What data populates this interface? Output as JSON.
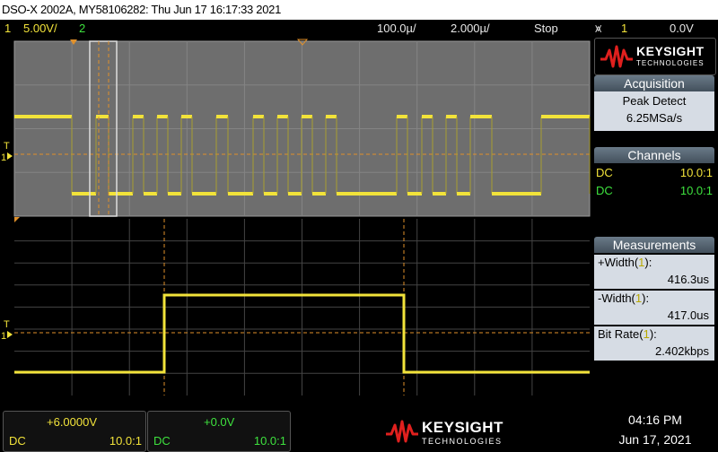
{
  "title": "DSO-X 2002A, MY58106282: Thu Jun 17 16:17:33 2021",
  "status": {
    "ch1_num": "1",
    "ch1_scale": "5.00V/",
    "ch2_num": "2",
    "time_ref": "100.0µ/",
    "time_scale": "2.000µ/",
    "run_state": "Stop",
    "trigger_icon": "⩙",
    "trigger_src": "1",
    "trigger_level": "0.0V"
  },
  "colors": {
    "ch1": "#f2e33a",
    "ch2": "#3ee23e",
    "grid": "#7a7a7a"
  },
  "brand": {
    "name": "KEYSIGHT",
    "sub": "TECHNOLOGIES"
  },
  "acquisition": {
    "header": "Acquisition",
    "mode": "Peak Detect",
    "rate": "6.25MSa/s"
  },
  "channels": {
    "header": "Channels",
    "rows": [
      {
        "coupling": "DC",
        "probe": "10.0:1"
      },
      {
        "coupling": "DC",
        "probe": "10.0:1"
      }
    ]
  },
  "measurements": {
    "header": "Measurements",
    "items": [
      {
        "label_pre": "+Width(",
        "ch": "1",
        "label_post": "):",
        "value": "416.3us"
      },
      {
        "label_pre": "-Width(",
        "ch": "1",
        "label_post": "):",
        "value": "417.0us"
      },
      {
        "label_pre": "Bit Rate(",
        "ch": "1",
        "label_post": "):",
        "value": "2.402kbps"
      }
    ]
  },
  "bottom": {
    "ch1_offset": "+6.0000V",
    "ch1_coupling": "DC",
    "ch1_probe": "10.0:1",
    "ch2_offset": "+0.0V",
    "ch2_coupling": "DC",
    "ch2_probe": "10.0:1",
    "time": "04:16 PM",
    "date": "Jun 17, 2021"
  },
  "markers": {
    "trigger": "T",
    "ch1": "1"
  }
}
